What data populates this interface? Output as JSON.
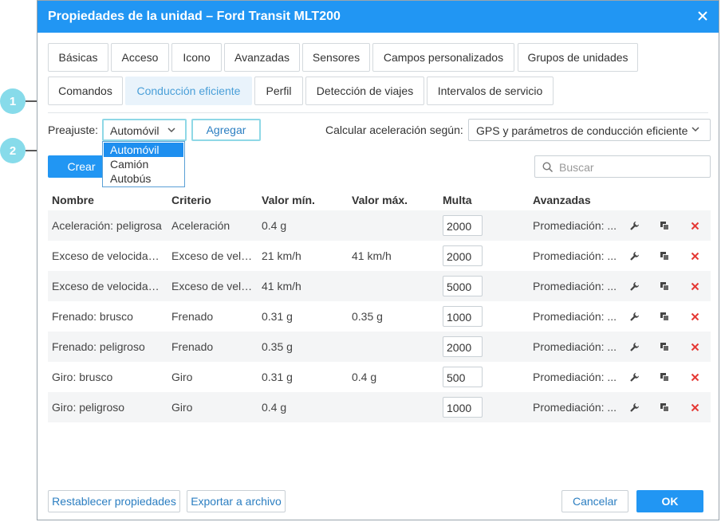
{
  "dialog": {
    "title": "Propiedades de la unidad – Ford Transit MLT200"
  },
  "tabs": [
    {
      "label": "Básicas"
    },
    {
      "label": "Acceso"
    },
    {
      "label": "Icono"
    },
    {
      "label": "Avanzadas"
    },
    {
      "label": "Sensores"
    },
    {
      "label": "Campos personalizados"
    },
    {
      "label": "Grupos de unidades"
    },
    {
      "label": "Comandos"
    },
    {
      "label": "Conducción eficiente"
    },
    {
      "label": "Perfil"
    },
    {
      "label": "Detección de viajes"
    },
    {
      "label": "Intervalos de servicio"
    }
  ],
  "toolbar": {
    "preset_label": "Preajuste:",
    "preset_value": "Automóvil",
    "add_label": "Agregar",
    "accel_label": "Calcular aceleración según:",
    "accel_value": "GPS y parámetros de conducción eficiente",
    "create_label": "Crear",
    "search_placeholder": "Buscar"
  },
  "dropdown": {
    "options": [
      "Automóvil",
      "Camión",
      "Autobús"
    ]
  },
  "table": {
    "headers": [
      "Nombre",
      "Criterio",
      "Valor mín.",
      "Valor máx.",
      "Multa",
      "Avanzadas"
    ],
    "rows": [
      {
        "name": "Aceleración: peligrosa",
        "criterion": "Aceleración",
        "min": "0.4 g",
        "max": "",
        "fine": "2000",
        "advanced": "Promediación: ..."
      },
      {
        "name": "Exceso de velocidad:...",
        "criterion": "Exceso de velo...",
        "min": "21 km/h",
        "max": "41 km/h",
        "fine": "2000",
        "advanced": "Promediación: ..."
      },
      {
        "name": "Exceso de velocidad:...",
        "criterion": "Exceso de velo...",
        "min": "41 km/h",
        "max": "",
        "fine": "5000",
        "advanced": "Promediación: ..."
      },
      {
        "name": "Frenado: brusco",
        "criterion": "Frenado",
        "min": "0.31 g",
        "max": "0.35 g",
        "fine": "1000",
        "advanced": "Promediación: ..."
      },
      {
        "name": "Frenado: peligroso",
        "criterion": "Frenado",
        "min": "0.35 g",
        "max": "",
        "fine": "2000",
        "advanced": "Promediación: ..."
      },
      {
        "name": "Giro: brusco",
        "criterion": "Giro",
        "min": "0.31 g",
        "max": "0.4 g",
        "fine": "500",
        "advanced": "Promediación: ..."
      },
      {
        "name": "Giro: peligroso",
        "criterion": "Giro",
        "min": "0.4 g",
        "max": "",
        "fine": "1000",
        "advanced": "Promediación: ..."
      }
    ]
  },
  "footer": {
    "reset_label": "Restablecer propiedades",
    "export_label": "Exportar a archivo",
    "cancel_label": "Cancelar",
    "ok_label": "OK"
  },
  "callouts": [
    "1",
    "2"
  ],
  "colors": {
    "accent": "#2196f3",
    "delete": "#e53935",
    "callout": "#87dbea"
  }
}
